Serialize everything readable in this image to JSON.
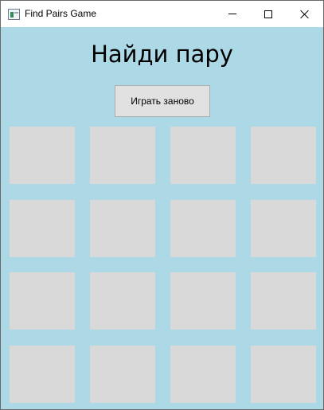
{
  "window": {
    "title": "Find Pairs Game",
    "icon": "app-window-icon",
    "controls": [
      "minimize-icon",
      "maximize-icon",
      "close-icon"
    ]
  },
  "game": {
    "heading": "Найди пару",
    "restart_label": "Играть заново",
    "grid": {
      "rows": 4,
      "cols": 4,
      "card_state": "face-down"
    }
  },
  "colors": {
    "background": "#add8e6",
    "card": "#d9d9d9",
    "button": "#e1e1e1"
  }
}
